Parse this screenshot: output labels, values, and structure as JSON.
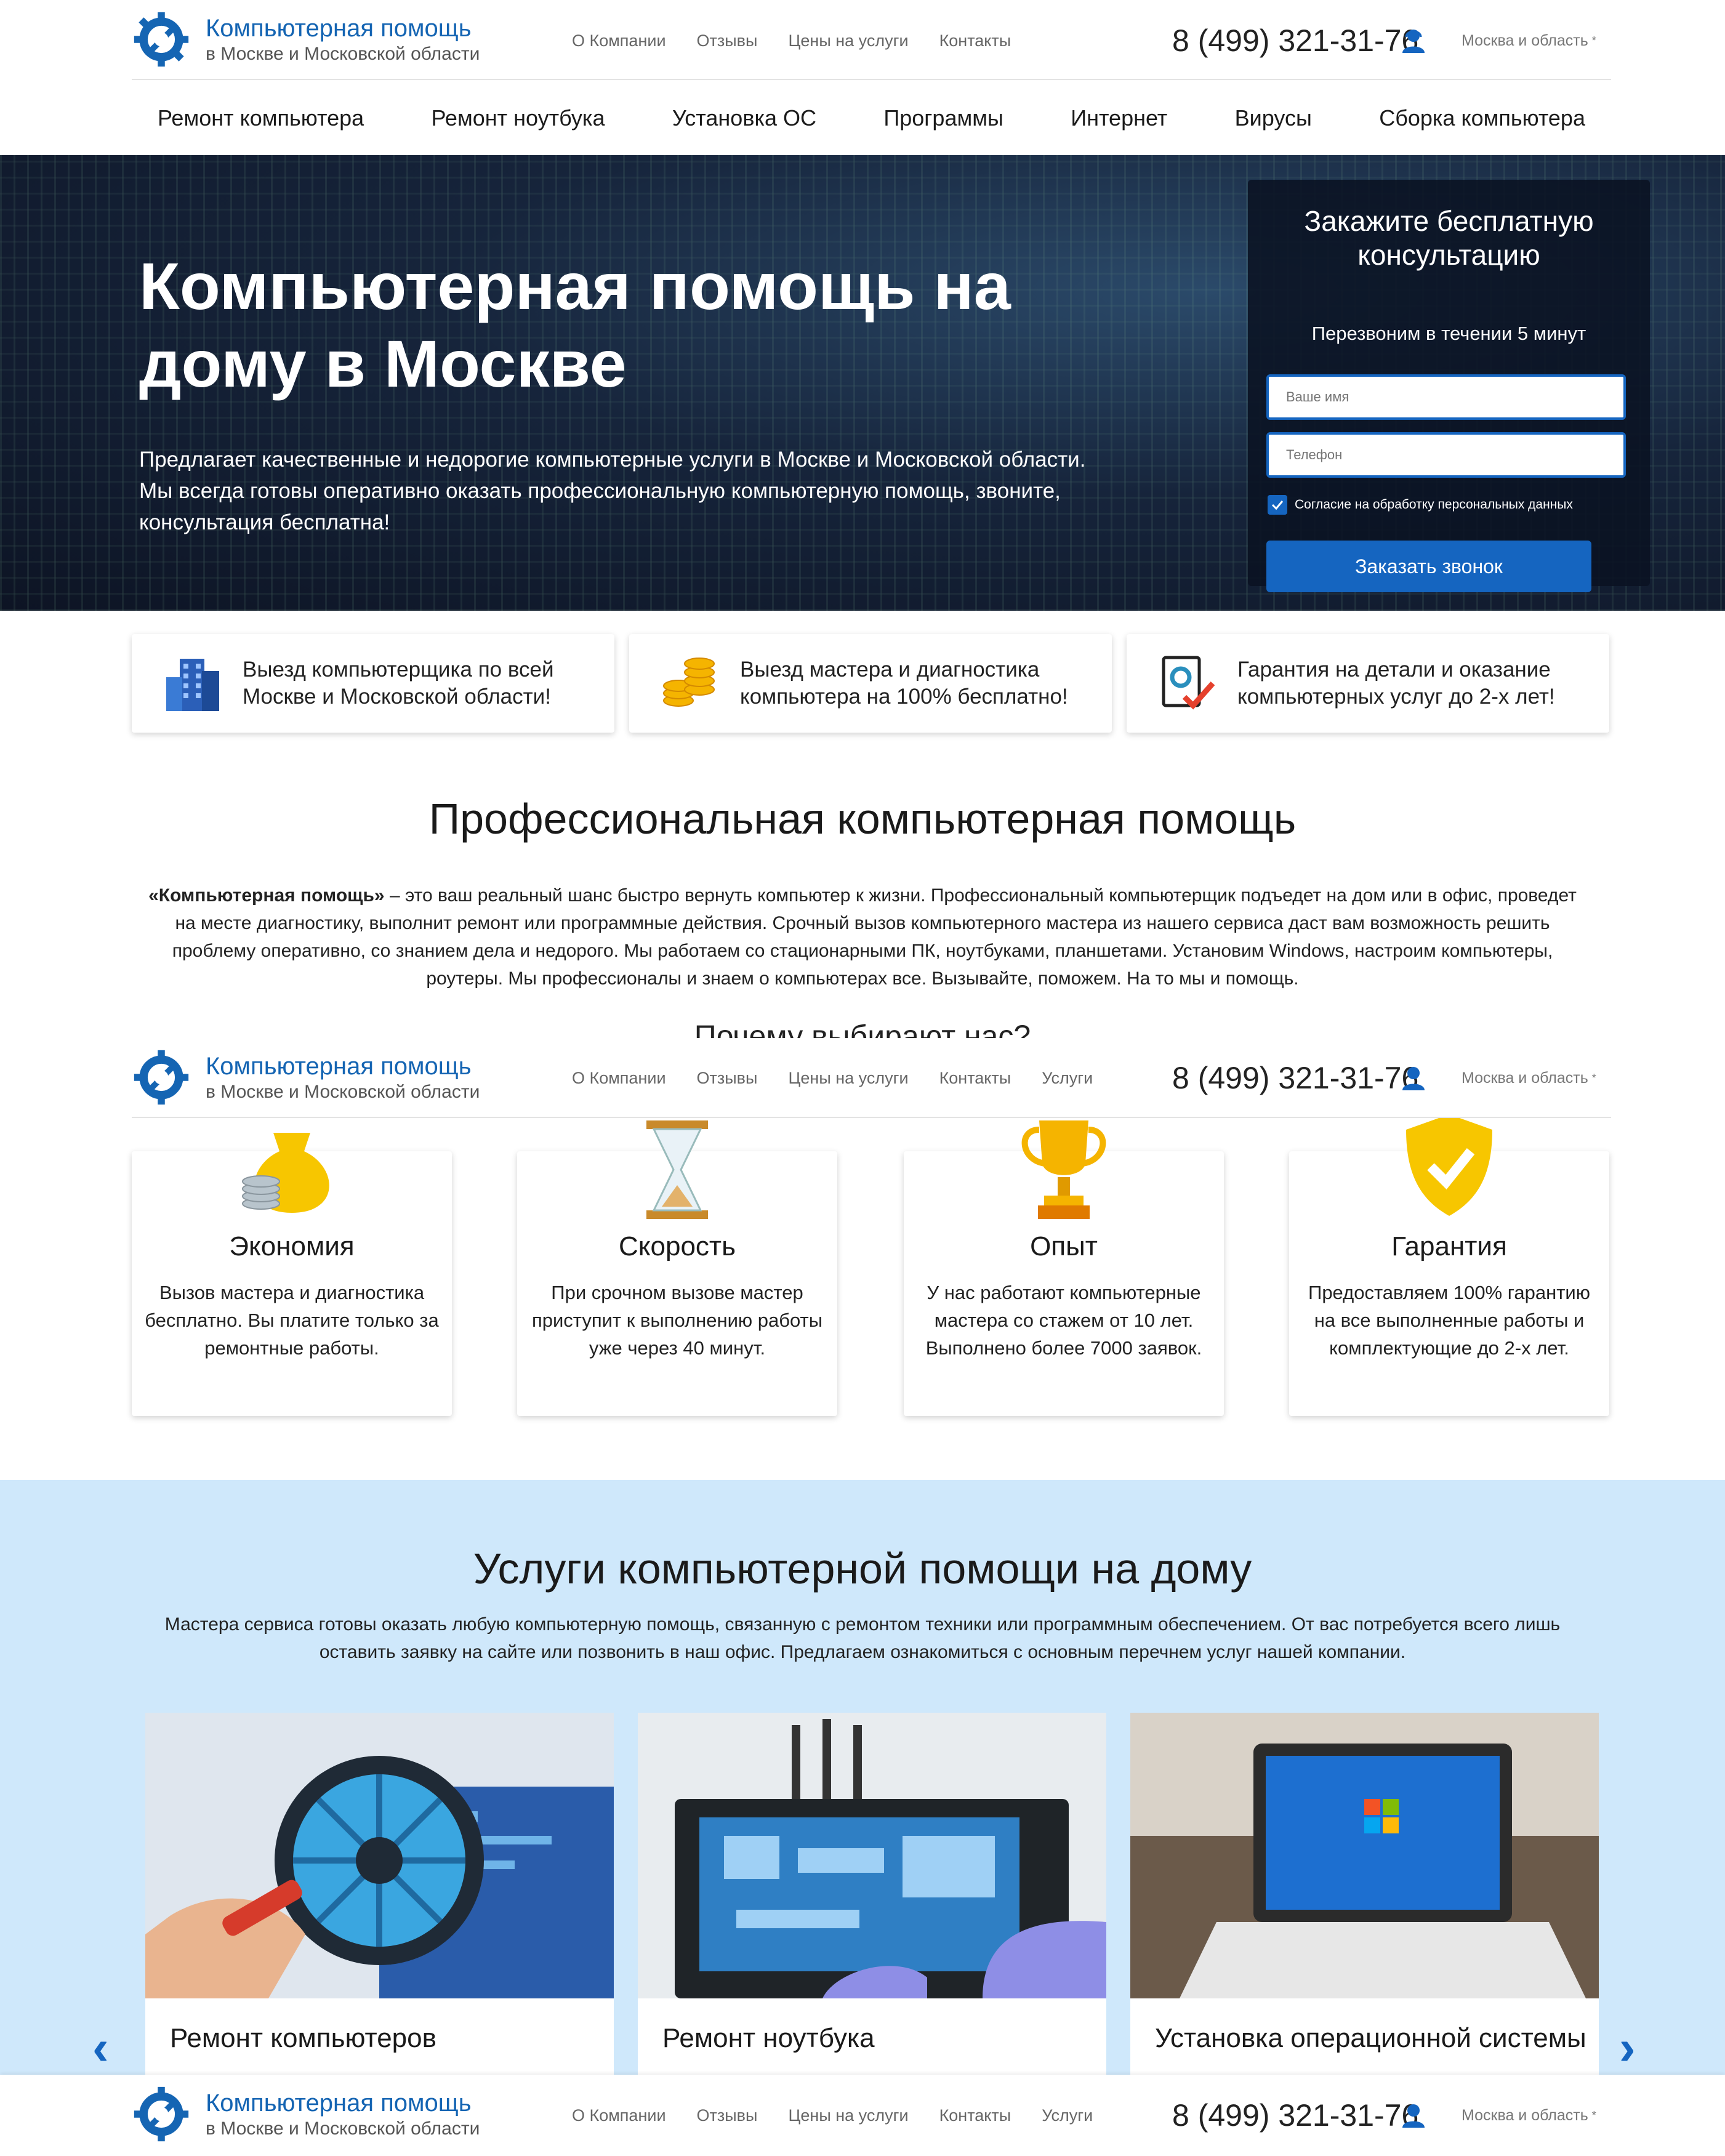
{
  "logo": {
    "title": "Компьютерная помощь",
    "subtitle": "в Москве и Московской области"
  },
  "top_nav": [
    "О Компании",
    "Отзывы",
    "Цены на услуги",
    "Контакты"
  ],
  "top_nav_sticky": [
    "О Компании",
    "Отзывы",
    "Цены на услуги",
    "Контакты",
    "Услуги"
  ],
  "phone": "8 (499) 321-31-76",
  "region": "Москва и область",
  "main_nav": [
    "Ремонт компьютера",
    "Ремонт ноутбука",
    "Установка ОС",
    "Программы",
    "Интернет",
    "Вирусы",
    "Сборка компьютера"
  ],
  "hero": {
    "title": "Компьютерная помощь на дому в Москве",
    "text": "Предлагает качественные и недорогие компьютерные услуги в Москве и Московской области. Мы всегда готовы оперативно оказать профессиональную компьютерную помощь, звоните, консультация бесплатна!"
  },
  "form": {
    "title": "Закажите бесплатную консультацию",
    "subtitle": "Перезвоним в течении 5 минут",
    "name_placeholder": "Ваше имя",
    "phone_placeholder": "Телефон",
    "consent": "Согласие на обработку персональных данных",
    "button": "Заказать звонок"
  },
  "features": [
    {
      "icon": "building-icon",
      "text": "Выезд компьютерщика по всей Москве и Московской области!"
    },
    {
      "icon": "coins-icon",
      "text": "Выезд мастера и диагностика компьютера на 100% бесплатно!"
    },
    {
      "icon": "guarantee-icon",
      "text": "Гарантия на детали и оказание компьютерных услуг до 2-х лет!"
    }
  ],
  "professional": {
    "title": "Профессиональная компьютерная помощь",
    "lead_bold": "«Компьютерная помощь»",
    "text": " – это ваш реальный шанс быстро вернуть компьютер к жизни. Профессиональный компьютерщик подъедет на дом или в офис, проведет на месте диагностику, выполнит ремонт или программные действия. Срочный вызов компьютерного мастера из нашего сервиса даст вам возможность решить проблему оперативно, со знанием дела и недорого. Мы работаем со стационарными ПК, ноутбуками, планшетами. Установим Windows, настроим компьютеры, роутеры. Мы профессионалы и знаем о компьютерах все. Вызывайте, поможем. На то мы и помощь."
  },
  "why_title": "Почему выбирают нас?",
  "advantages": [
    {
      "icon": "money-bag-icon",
      "title": "Экономия",
      "text": "Вызов мастера и диагностика бесплатно. Вы платите только за ремонтные работы."
    },
    {
      "icon": "hourglass-icon",
      "title": "Скорость",
      "text": "При срочном вызове мастер приступит к выполнению работы уже через 40 минут."
    },
    {
      "icon": "trophy-icon",
      "title": "Опыт",
      "text": "У нас работают компьютерные мастера со стажем от 10 лет. Выполнено более 7000 заявок."
    },
    {
      "icon": "shield-check-icon",
      "title": "Гарантия",
      "text": "Предоставляем 100% гарантию на все выполненные работы и комплектующие до 2-х лет."
    }
  ],
  "services": {
    "title": "Услуги компьютерной помощи на дому",
    "text": "Мастера сервиса готовы оказать любую компьютерную помощь, связанную с ремонтом техники или программным обеспечением. От вас потребуется всего лишь оставить заявку на сайте или позвонить в наш офис. Предлагаем ознакомиться с основным перечнем услуг нашей компании.",
    "items": [
      {
        "title": "Ремонт компьютеров"
      },
      {
        "title": "Ремонт ноутбука"
      },
      {
        "title": "Установка операционной системы"
      }
    ],
    "prev": "‹",
    "next": "›"
  },
  "colors": {
    "brand": "#1565c0",
    "services_bg": "#cfe8fb"
  }
}
